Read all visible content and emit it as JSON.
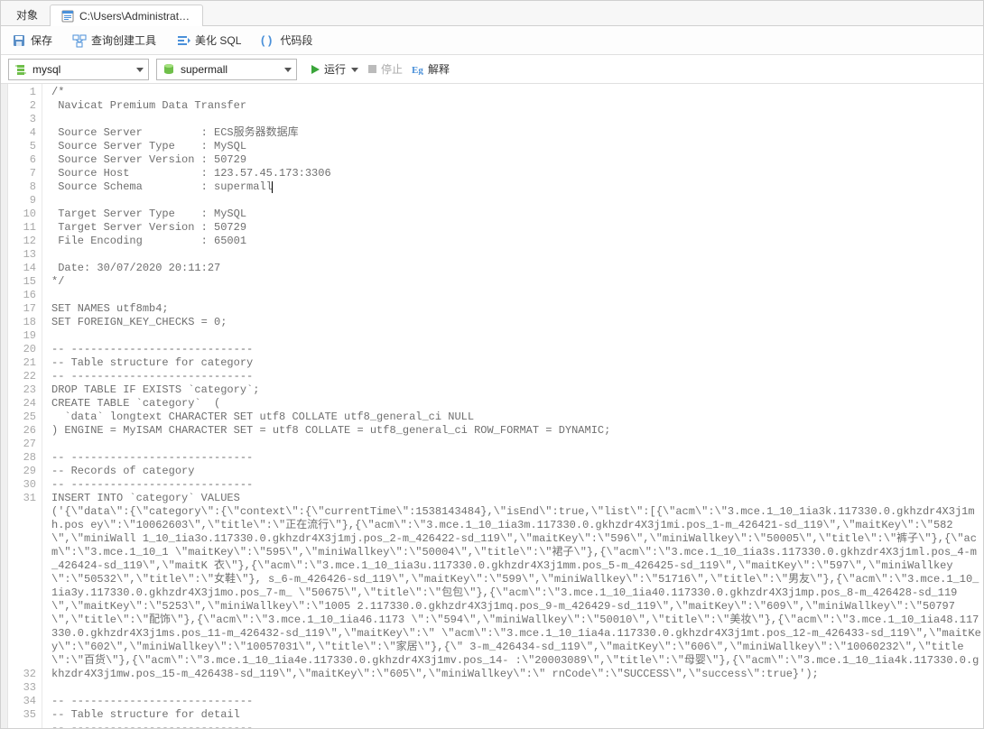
{
  "tabs": {
    "objects": "对象",
    "file_icon": "sql-file-icon",
    "file_path": "C:\\Users\\Administrator\\Do..."
  },
  "toolbar": {
    "save": "保存",
    "query_builder": "查询创建工具",
    "beautify_sql": "美化 SQL",
    "code_snippet": "代码段"
  },
  "conn": {
    "connection": "mysql",
    "database": "supermall"
  },
  "actions": {
    "run": "运行",
    "stop": "停止",
    "explain": "解释"
  },
  "editor": {
    "lines": [
      "/*",
      " Navicat Premium Data Transfer",
      "",
      " Source Server         : ECS服务器数据库",
      " Source Server Type    : MySQL",
      " Source Server Version : 50729",
      " Source Host           : 123.57.45.173:3306",
      " Source Schema         : supermall",
      "",
      " Target Server Type    : MySQL",
      " Target Server Version : 50729",
      " File Encoding         : 65001",
      "",
      " Date: 30/07/2020 20:11:27",
      "*/",
      "",
      "SET NAMES utf8mb4;",
      "SET FOREIGN_KEY_CHECKS = 0;",
      "",
      "-- ----------------------------",
      "-- Table structure for category",
      "-- ----------------------------",
      "DROP TABLE IF EXISTS `category`;",
      "CREATE TABLE `category`  (",
      "  `data` longtext CHARACTER SET utf8 COLLATE utf8_general_ci NULL",
      ") ENGINE = MyISAM CHARACTER SET = utf8 COLLATE = utf8_general_ci ROW_FORMAT = DYNAMIC;",
      "",
      "-- ----------------------------",
      "-- Records of category",
      "-- ----------------------------",
      "INSERT INTO `category` VALUES"
    ],
    "caret_line_index": 7,
    "wrapped_block": "('{\\\"data\\\":{\\\"category\\\":{\\\"context\\\":{\\\"currentTime\\\":1538143484},\\\"isEnd\\\":true,\\\"list\\\":[{\\\"acm\\\":\\\"3.mce.1_10_1ia3k.117330.0.gkhzdr4X3j1mh.pos ey\\\":\\\"10062603\\\",\\\"title\\\":\\\"正在流行\\\"},{\\\"acm\\\":\\\"3.mce.1_10_1ia3m.117330.0.gkhzdr4X3j1mi.pos_1-m_426421-sd_119\\\",\\\"maitKey\\\":\\\"582\\\",\\\"miniWall 1_10_1ia3o.117330.0.gkhzdr4X3j1mj.pos_2-m_426422-sd_119\\\",\\\"maitKey\\\":\\\"596\\\",\\\"miniWallkey\\\":\\\"50005\\\",\\\"title\\\":\\\"裤子\\\"},{\\\"acm\\\":\\\"3.mce.1_10_1 \\\"maitKey\\\":\\\"595\\\",\\\"miniWallkey\\\":\\\"50004\\\",\\\"title\\\":\\\"裙子\\\"},{\\\"acm\\\":\\\"3.mce.1_10_1ia3s.117330.0.gkhzdr4X3j1ml.pos_4-m_426424-sd_119\\\",\\\"maitK 衣\\\"},{\\\"acm\\\":\\\"3.mce.1_10_1ia3u.117330.0.gkhzdr4X3j1mm.pos_5-m_426425-sd_119\\\",\\\"maitKey\\\":\\\"597\\\",\\\"miniWallkey\\\":\\\"50532\\\",\\\"title\\\":\\\"女鞋\\\"}, s_6-m_426426-sd_119\\\",\\\"maitKey\\\":\\\"599\\\",\\\"miniWallkey\\\":\\\"51716\\\",\\\"title\\\":\\\"男友\\\"},{\\\"acm\\\":\\\"3.mce.1_10_1ia3y.117330.0.gkhzdr4X3j1mo.pos_7-m_ \\\"50675\\\",\\\"title\\\":\\\"包包\\\"},{\\\"acm\\\":\\\"3.mce.1_10_1ia40.117330.0.gkhzdr4X3j1mp.pos_8-m_426428-sd_119\\\",\\\"maitKey\\\":\\\"5253\\\",\\\"miniWallkey\\\":\\\"1005 2.117330.0.gkhzdr4X3j1mq.pos_9-m_426429-sd_119\\\",\\\"maitKey\\\":\\\"609\\\",\\\"miniWallkey\\\":\\\"50797\\\",\\\"title\\\":\\\"配饰\\\"},{\\\"acm\\\":\\\"3.mce.1_10_1ia46.1173 \\\":\\\"594\\\",\\\"miniWallkey\\\":\\\"50010\\\",\\\"title\\\":\\\"美妆\\\"},{\\\"acm\\\":\\\"3.mce.1_10_1ia48.117330.0.gkhzdr4X3j1ms.pos_11-m_426432-sd_119\\\",\\\"maitKey\\\":\\\" \\\"acm\\\":\\\"3.mce.1_10_1ia4a.117330.0.gkhzdr4X3j1mt.pos_12-m_426433-sd_119\\\",\\\"maitKey\\\":\\\"602\\\",\\\"miniWallkey\\\":\\\"10057031\\\",\\\"title\\\":\\\"家居\\\"},{\\\" 3-m_426434-sd_119\\\",\\\"maitKey\\\":\\\"606\\\",\\\"miniWallkey\\\":\\\"10060232\\\",\\\"title\\\":\\\"百货\\\"},{\\\"acm\\\":\\\"3.mce.1_10_1ia4e.117330.0.gkhzdr4X3j1mv.pos_14- :\\\"20003089\\\",\\\"title\\\":\\\"母婴\\\"},{\\\"acm\\\":\\\"3.mce.1_10_1ia4k.117330.0.gkhzdr4X3j1mw.pos_15-m_426438-sd_119\\\",\\\"maitKey\\\":\\\"605\\\",\\\"miniWallkey\\\":\\\" rnCode\\\":\\\"SUCCESS\\\",\\\"success\\\":true}');",
    "tail_lines": [
      "",
      "-- ----------------------------",
      "-- Table structure for detail",
      "-- ----------------------------"
    ],
    "tail_start_number": 32
  }
}
